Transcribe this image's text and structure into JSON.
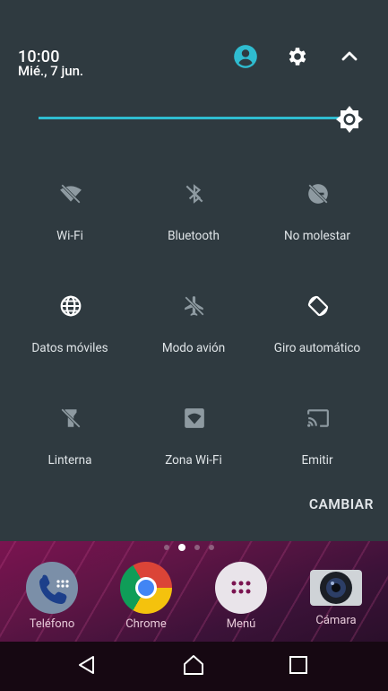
{
  "status": {
    "time": "10:00",
    "date": "Mié., 7 jun."
  },
  "header_icons": [
    "account-icon",
    "settings-icon",
    "collapse-chevron-icon"
  ],
  "brightness": {
    "level": 0.97,
    "accent": "#2fbcd0"
  },
  "tiles": [
    {
      "label": "Wi-Fi",
      "icon": "wifi-off-icon"
    },
    {
      "label": "Bluetooth",
      "icon": "bluetooth-off-icon"
    },
    {
      "label": "No molestar",
      "icon": "do-not-disturb-off-icon"
    },
    {
      "label": "Datos móviles",
      "icon": "globe-icon"
    },
    {
      "label": "Modo avión",
      "icon": "airplane-off-icon"
    },
    {
      "label": "Giro automático",
      "icon": "auto-rotate-icon"
    },
    {
      "label": "Linterna",
      "icon": "flashlight-off-icon"
    },
    {
      "label": "Zona Wi-Fi",
      "icon": "hotspot-icon"
    },
    {
      "label": "Emitir",
      "icon": "cast-icon"
    }
  ],
  "cambiar_label": "CAMBIAR",
  "dock": [
    {
      "label": "Teléfono",
      "icon": "phone-icon"
    },
    {
      "label": "Chrome",
      "icon": "chrome-icon"
    },
    {
      "label": "Menú",
      "icon": "app-menu-icon"
    },
    {
      "label": "Cámara",
      "icon": "camera-icon"
    }
  ],
  "nav": [
    "back-icon",
    "home-icon",
    "recents-icon"
  ]
}
